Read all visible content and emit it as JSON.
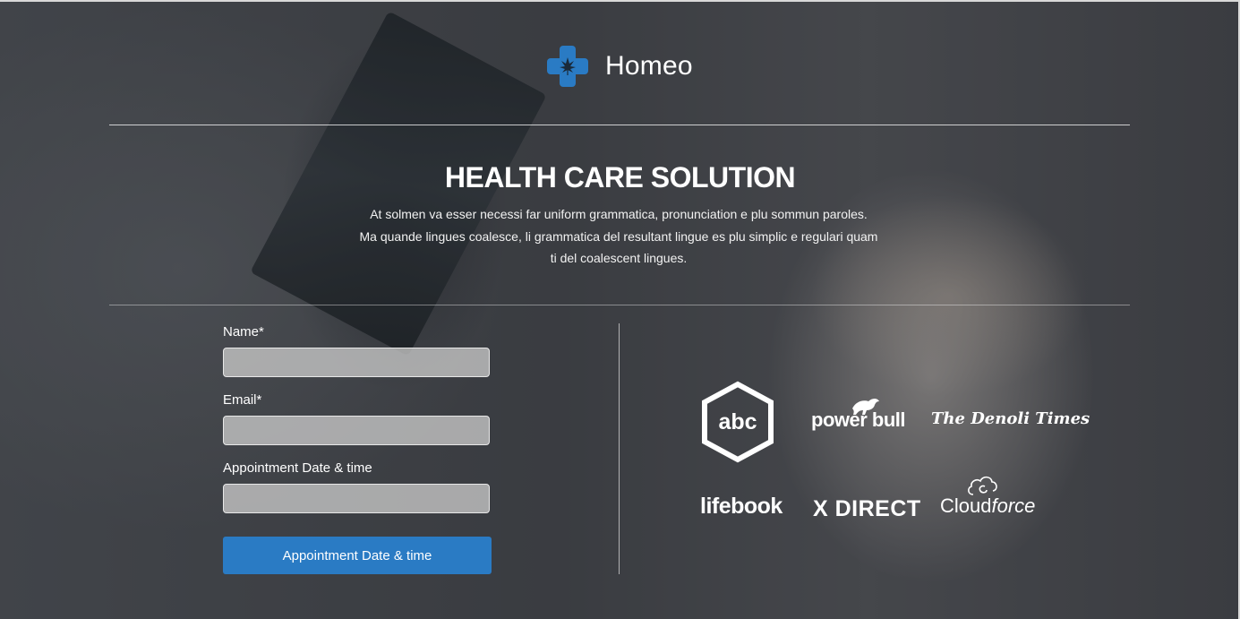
{
  "brand": {
    "name": "Homeo",
    "icon": "medical-cross-icon",
    "accent_color": "#2a7bc4"
  },
  "hero": {
    "title": "HEALTH CARE SOLUTION",
    "lines": [
      "At solmen va esser necessi far uniform grammatica, pronunciation e plu sommun paroles.",
      "Ma quande lingues coalesce, li grammatica del resultant lingue es plu simplic e regulari quam",
      "ti del coalescent lingues."
    ]
  },
  "form": {
    "name_label": "Name*",
    "name_value": "",
    "email_label": "Email*",
    "email_value": "",
    "datetime_label": "Appointment Date & time",
    "datetime_value": "",
    "submit_label": "Appointment Date & time",
    "button_color": "#2a7bc4"
  },
  "logos": [
    {
      "text": "abc"
    },
    {
      "text": "power bull"
    },
    {
      "text": "The Denoli Times"
    },
    {
      "text": "lifebook"
    },
    {
      "text": "X DIRECT"
    },
    {
      "text": "Cloud",
      "suffix": "force"
    }
  ]
}
